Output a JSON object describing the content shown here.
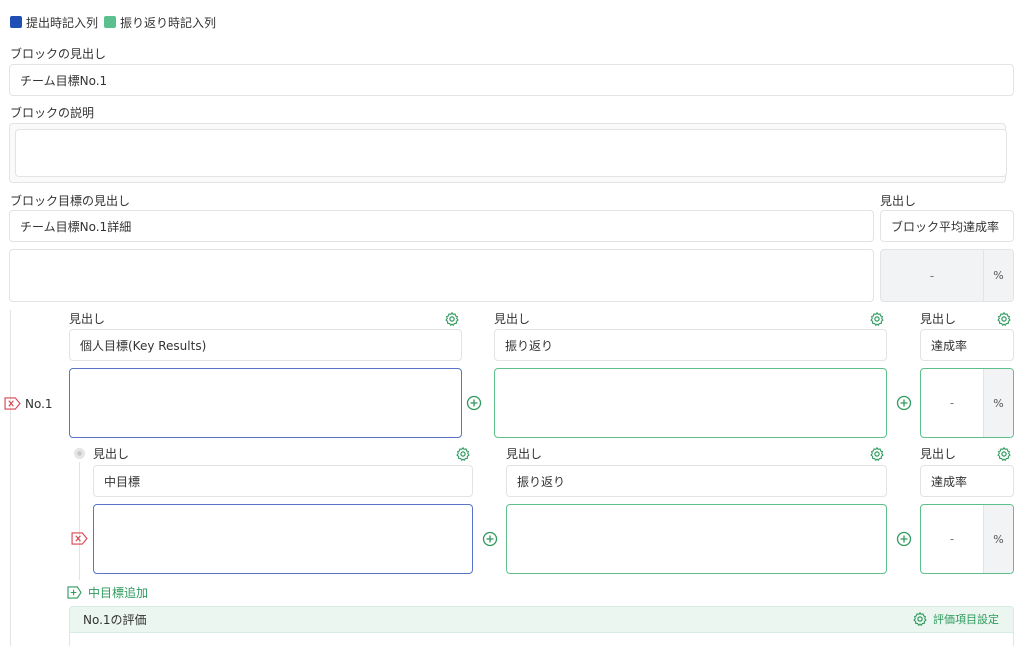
{
  "legend": {
    "submit_label": "提出時記入列",
    "review_label": "振り返り時記入列",
    "submit_color": "#1f4fb4",
    "review_color": "#5bc08e"
  },
  "block": {
    "heading_label": "ブロックの見出し",
    "heading_value": "チーム目標No.1",
    "desc_label": "ブロックの説明",
    "goal_heading_label": "ブロック目標の見出し",
    "goal_heading_value": "チーム目標No.1詳細",
    "side_heading_label": "見出し",
    "side_heading_value": "ブロック平均達成率",
    "side_rate_value": "-",
    "percent": "%"
  },
  "item": {
    "no_label": "No.1",
    "col1_label": "見出し",
    "col1_value": "個人目標(Key Results)",
    "col2_label": "見出し",
    "col2_value": "振り返り",
    "col3_label": "見出し",
    "col3_value": "達成率",
    "rate_value": "-",
    "percent": "%"
  },
  "sub": {
    "col1_label": "見出し",
    "col1_value": "中目標",
    "col2_label": "見出し",
    "col2_value": "振り返り",
    "col3_label": "見出し",
    "col3_value": "達成率",
    "rate_value": "-",
    "percent": "%",
    "add_label": "中目標追加"
  },
  "eval": {
    "title": "No.1の評価",
    "settings_label": "評価項目設定"
  },
  "icons": {
    "gear": "gear-icon",
    "plus": "plus-circle-icon",
    "remove": "remove-tag-icon",
    "add": "add-box-icon",
    "drag": "drag-handle-icon"
  },
  "colors": {
    "accent_green": "#2e9a5e",
    "danger": "#d9434f",
    "blue_border": "#5a75c8",
    "green_border": "#5fbf8a"
  }
}
